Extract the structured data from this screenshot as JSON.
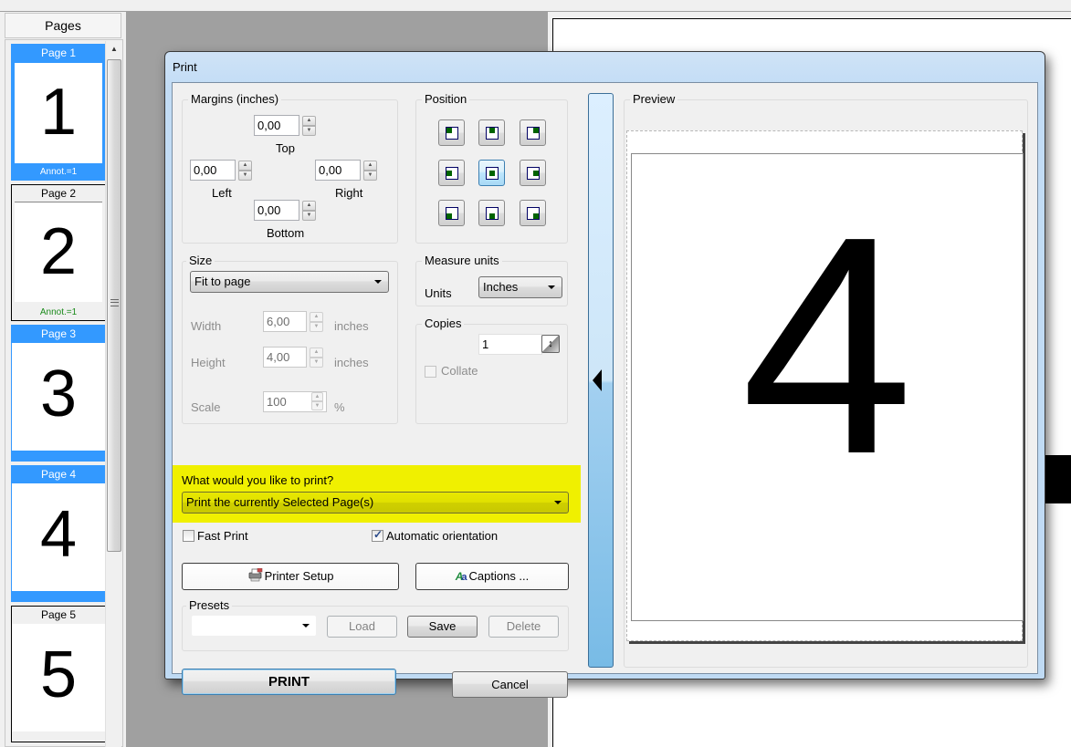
{
  "pages_panel": {
    "header": "Pages",
    "thumbnails": [
      {
        "title": "Page 1",
        "digit": "1",
        "annot": "Annot.=1",
        "state": "selected"
      },
      {
        "title": "Page 2",
        "digit": "2",
        "annot": "Annot.=1",
        "state": "normal"
      },
      {
        "title": "Page 3",
        "digit": "3",
        "annot": "",
        "state": "highlighted"
      },
      {
        "title": "Page 4",
        "digit": "4",
        "annot": "",
        "state": "highlighted"
      },
      {
        "title": "Page 5",
        "digit": "5",
        "annot": "",
        "state": "normal"
      }
    ]
  },
  "dialog": {
    "title": "Print",
    "margins": {
      "label": "Margins (inches)",
      "top": {
        "value": "0,00",
        "label": "Top"
      },
      "left": {
        "value": "0,00",
        "label": "Left"
      },
      "right": {
        "value": "0,00",
        "label": "Right"
      },
      "bottom": {
        "value": "0,00",
        "label": "Bottom"
      }
    },
    "position": {
      "label": "Position",
      "options": [
        "top-left",
        "top-center",
        "top-right",
        "middle-left",
        "center",
        "middle-right",
        "bottom-left",
        "bottom-center",
        "bottom-right"
      ],
      "selected": "center"
    },
    "size": {
      "label": "Size",
      "mode": "Fit to page",
      "width": {
        "label": "Width",
        "value": "6,00",
        "unit": "inches"
      },
      "height": {
        "label": "Height",
        "value": "4,00",
        "unit": "inches"
      },
      "scale": {
        "label": "Scale",
        "value": "100",
        "unit": "%"
      }
    },
    "measure_units": {
      "label": "Measure units",
      "units_label": "Units",
      "units_value": "Inches"
    },
    "copies": {
      "label": "Copies",
      "value": "1",
      "collate_label": "Collate",
      "collate_checked": false
    },
    "what_to_print": {
      "question": "What would you like to print?",
      "value": "Print the currently Selected Page(s)",
      "highlight_color": "#f0f000"
    },
    "fast_print": {
      "label": "Fast Print",
      "checked": false
    },
    "auto_orientation": {
      "label": "Automatic orientation",
      "checked": true
    },
    "printer_setup_label": "Printer Setup",
    "captions_label": "Captions ...",
    "presets": {
      "label": "Presets",
      "value": "",
      "load_label": "Load",
      "save_label": "Save",
      "delete_label": "Delete"
    },
    "print_label": "PRINT",
    "cancel_label": "Cancel",
    "preview": {
      "label": "Preview",
      "digit": "4"
    }
  }
}
